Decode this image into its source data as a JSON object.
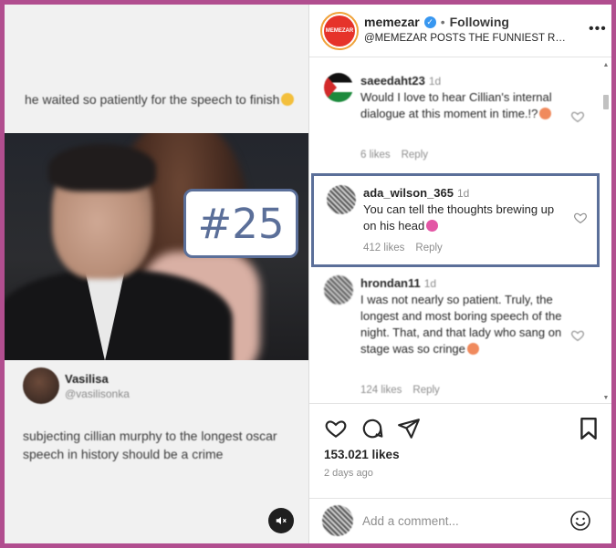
{
  "post_media": {
    "caption_top": "he waited so patiently for the speech to finish",
    "author_name": "Vasilisa",
    "author_handle": "@vasilisonka",
    "tweet_text": "subjecting cillian murphy to the longest oscar speech in history should be a crime",
    "mute_icon": "speaker-muted-icon"
  },
  "header": {
    "logo_text": "MEMEZAR",
    "username": "memezar",
    "separator": "•",
    "follow_state": "Following",
    "bio": "@MEMEZAR POSTS THE FUNNIEST REEL...",
    "more": "•••"
  },
  "comments": [
    {
      "username": "saeedaht23",
      "age": "1d",
      "text": "Would I love to hear Cillian's internal dialogue at this moment in time.!?",
      "likes": "6 likes",
      "reply": "Reply"
    },
    {
      "username": "ada_wilson_365",
      "age": "1d",
      "text": "You can tell the thoughts brewing up on his head",
      "likes": "412 likes",
      "reply": "Reply"
    },
    {
      "username": "hrondan11",
      "age": "1d",
      "text": "I was not nearly so patient. Truly, the longest and most boring speech of the night. That, and that lady who sang on stage was so cringe",
      "likes": "124 likes",
      "reply": "Reply"
    }
  ],
  "overlay_badge": "#25",
  "actions": {
    "likes": "153.021 likes",
    "date": "2 days ago"
  },
  "composer": {
    "placeholder": "Add a comment..."
  },
  "colors": {
    "frame": "#b14e8f",
    "highlight": "#5b6f99",
    "brand_red": "#e6332a",
    "verified": "#3897f0"
  }
}
